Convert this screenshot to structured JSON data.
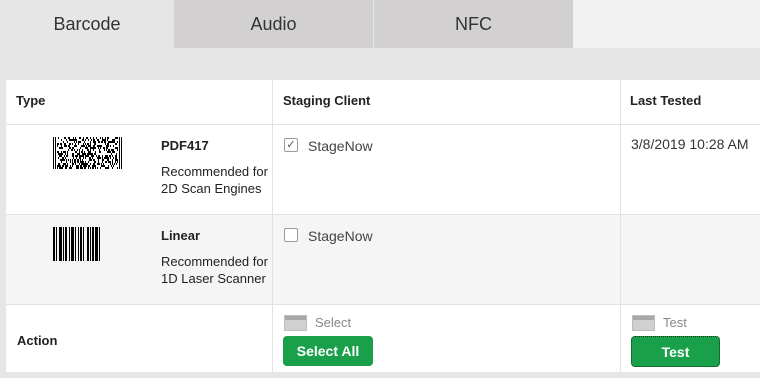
{
  "tabs": [
    {
      "label": "Barcode"
    },
    {
      "label": "Audio"
    },
    {
      "label": "NFC"
    }
  ],
  "table": {
    "headers": {
      "type": "Type",
      "staging_client": "Staging Client",
      "last_tested": "Last Tested"
    },
    "rows": [
      {
        "barcode_icon": "pdf417-barcode-icon",
        "name": "PDF417",
        "description": "Recommended for 2D Scan Engines",
        "client_label": "StageNow",
        "checked": true,
        "checkmark": "✓",
        "last_tested": "3/8/2019 10:28 AM"
      },
      {
        "barcode_icon": "linear-barcode-icon",
        "name": "Linear",
        "description": "Recommended for 1D Laser Scanner",
        "client_label": "StageNow",
        "checked": false,
        "checkmark": "",
        "last_tested": ""
      }
    ],
    "action": {
      "label": "Action",
      "select_icon_label": "Select",
      "select_all_label": "Select All",
      "test_icon_label": "Test",
      "test_label": "Test"
    }
  },
  "colors": {
    "button_green": "#1aa04a",
    "tab_inactive": "#d2d0d0",
    "background": "#e6e6e6"
  }
}
